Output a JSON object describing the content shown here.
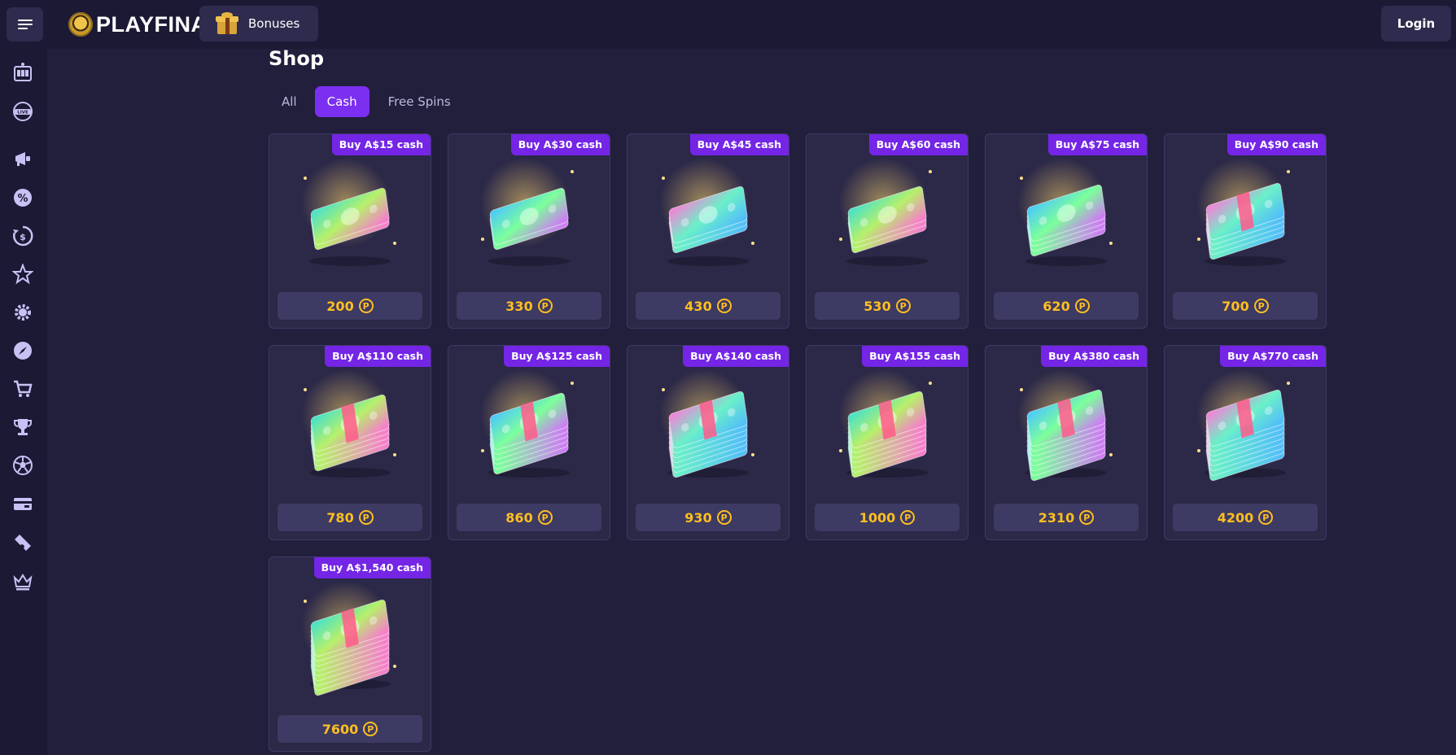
{
  "header": {
    "logo_text": "PLAYFINA",
    "bonuses_label": "Bonuses",
    "login_label": "Login"
  },
  "sidebar": {
    "items": [
      {
        "name": "slots-icon"
      },
      {
        "name": "live-casino-icon"
      },
      {
        "name": "megaphone-icon"
      },
      {
        "name": "percent-icon"
      },
      {
        "name": "cashback-icon"
      },
      {
        "name": "star-icon"
      },
      {
        "name": "settings-icon"
      },
      {
        "name": "compass-icon"
      },
      {
        "name": "cart-icon"
      },
      {
        "name": "trophy-icon"
      },
      {
        "name": "sports-icon"
      },
      {
        "name": "wallet-icon"
      },
      {
        "name": "ticket-icon"
      },
      {
        "name": "crown-icon"
      }
    ]
  },
  "main": {
    "title": "Shop",
    "tabs": [
      {
        "label": "All",
        "active": false
      },
      {
        "label": "Cash",
        "active": true
      },
      {
        "label": "Free Spins",
        "active": false
      }
    ],
    "coin_symbol": "P",
    "items": [
      {
        "badge": "Buy A$15 cash",
        "price": "200"
      },
      {
        "badge": "Buy A$30 cash",
        "price": "330"
      },
      {
        "badge": "Buy A$45 cash",
        "price": "430"
      },
      {
        "badge": "Buy A$60 cash",
        "price": "530"
      },
      {
        "badge": "Buy A$75 cash",
        "price": "620"
      },
      {
        "badge": "Buy A$90 cash",
        "price": "700"
      },
      {
        "badge": "Buy A$110 cash",
        "price": "780"
      },
      {
        "badge": "Buy A$125 cash",
        "price": "860"
      },
      {
        "badge": "Buy A$140 cash",
        "price": "930"
      },
      {
        "badge": "Buy A$155 cash",
        "price": "1000"
      },
      {
        "badge": "Buy A$380 cash",
        "price": "2310"
      },
      {
        "badge": "Buy A$770 cash",
        "price": "4200"
      },
      {
        "badge": "Buy A$1,540 cash",
        "price": "7600"
      }
    ]
  },
  "colors": {
    "accent": "#7b2ff0",
    "price": "#ffbf1f",
    "background": "#221f3d"
  }
}
